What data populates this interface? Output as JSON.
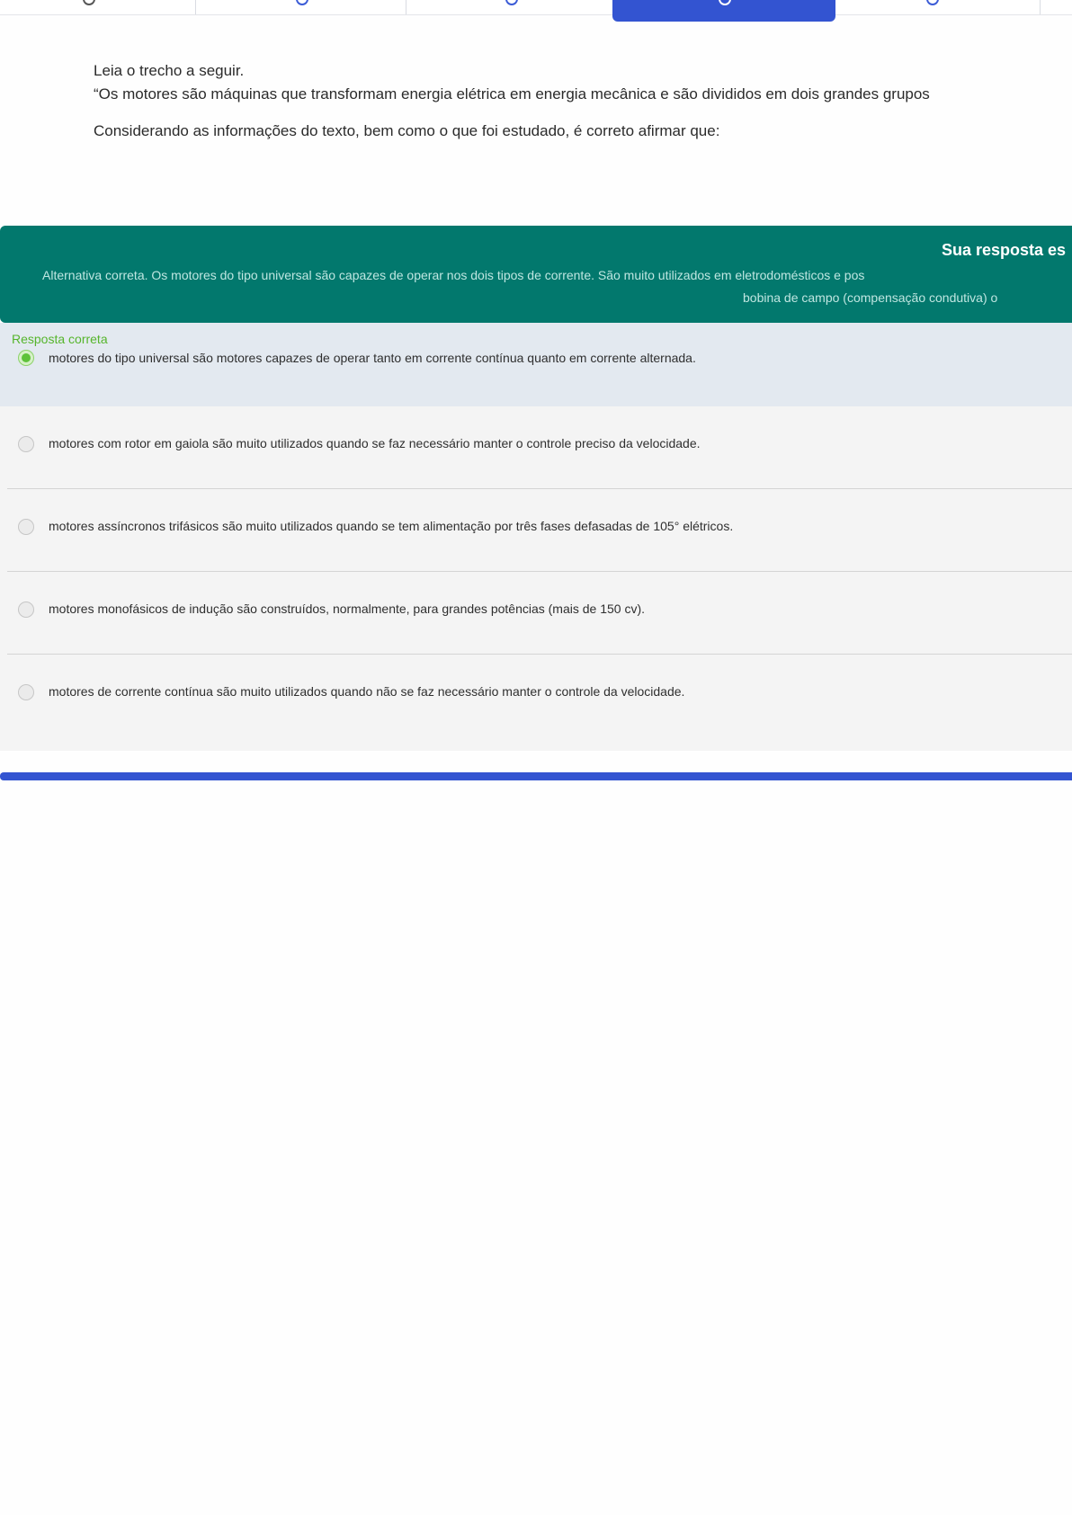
{
  "question": {
    "intro": "Leia o trecho a seguir.",
    "quote": "“Os motores são máquinas que transformam energia elétrica em energia mecânica e são divididos em dois grandes grupos",
    "prompt": "Considerando as informações do texto, bem como o que foi estudado, é correto afirmar que:"
  },
  "feedback": {
    "title": "Sua resposta es",
    "line1": "Alternativa correta. Os motores do tipo universal são capazes de operar nos dois tipos de corrente. São muito utilizados em eletrodomésticos e pos",
    "line2": "bobina de campo (compensação condutiva) o",
    "colors": {
      "background": "#02786d",
      "title": "#ffffff",
      "text": "#bfe6e1"
    }
  },
  "correct_label": "Resposta correta",
  "options": [
    {
      "text": "motores do tipo universal são motores capazes de operar tanto em corrente contínua quanto em corrente alternada.",
      "selected": true
    },
    {
      "text": "motores com rotor em gaiola são muito utilizados quando se faz necessário manter o controle preciso da velocidade.",
      "selected": false
    },
    {
      "text": "motores assíncronos trifásicos são muito utilizados quando se tem alimentação por três fases defasadas de 105° elétricos.",
      "selected": false
    },
    {
      "text": "motores monofásicos de indução são construídos, normalmente, para grandes potências (mais de 150 cv).",
      "selected": false
    },
    {
      "text": "motores de corrente contínua são muito utilizados quando não se faz necessário manter o controle da velocidade.",
      "selected": false
    }
  ],
  "colors": {
    "accent": "#3354d1",
    "correct_green": "#56b52c",
    "selected_option_bg": "#e3e9f0",
    "option_bg": "#f4f4f4"
  }
}
